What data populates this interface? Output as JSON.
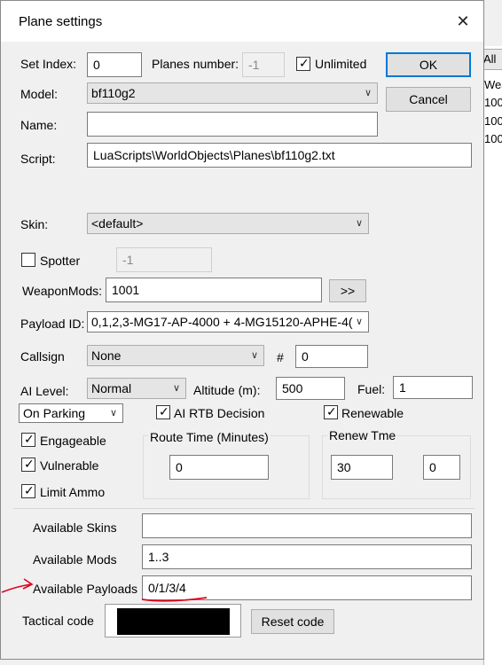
{
  "window": {
    "title": "Plane settings",
    "close_glyph": "✕"
  },
  "background_app": {
    "header_all": "All",
    "header_weapons": "Wea",
    "values": [
      "100",
      "100",
      "100"
    ]
  },
  "fields": {
    "set_index_label": "Set Index:",
    "set_index_value": "0",
    "planes_number_label": "Planes number:",
    "planes_number_value": "-1",
    "unlimited_label": "Unlimited",
    "model_label": "Model:",
    "model_value": "bf110g2",
    "name_label": "Name:",
    "name_value": "",
    "script_label": "Script:",
    "script_value": "LuaScripts\\WorldObjects\\Planes\\bf110g2.txt",
    "skin_label": "Skin:",
    "skin_value": "<default>",
    "spotter_label": "Spotter",
    "spotter_value": "-1",
    "weaponmods_label": "WeaponMods:",
    "weaponmods_value": "1001",
    "weaponmods_button": ">>",
    "payload_label": "Payload ID:",
    "payload_value": "0,1,2,3-MG17-AP-4000 + 4-MG15120-APHE-4(",
    "callsign_label": "Callsign",
    "callsign_value": "None",
    "hash_label": "#",
    "hash_value": "0",
    "ai_level_label": "AI Level:",
    "ai_level_value": "Normal",
    "altitude_label": "Altitude (m):",
    "altitude_value": "500",
    "fuel_label": "Fuel:",
    "fuel_value": "1",
    "start_value": "On Parking",
    "ai_rtb_label": "AI RTB Decision",
    "renewable_label": "Renewable",
    "engageable_label": "Engageable",
    "vulnerable_label": "Vulnerable",
    "limit_ammo_label": "Limit Ammo",
    "route_time_label": "Route Time (Minutes)",
    "route_time_value": "0",
    "renew_time_label": "Renew Tme",
    "renew_time_value_1": "30",
    "renew_time_value_2": "0",
    "available_skins_label": "Available Skins",
    "available_skins_value": "",
    "available_mods_label": "Available Mods",
    "available_mods_value": "1..3",
    "available_payloads_label": "Available Payloads",
    "available_payloads_value": "0/1/3/4",
    "tactical_code_label": "Tactical code",
    "reset_code_button": "Reset code"
  },
  "buttons": {
    "ok": "OK",
    "cancel": "Cancel"
  },
  "checkboxes": {
    "unlimited": true,
    "spotter": false,
    "ai_rtb": true,
    "renewable": true,
    "engageable": true,
    "vulnerable": true,
    "limit_ammo": true
  },
  "colors": {
    "annotation_red": "#e0001b",
    "tactical_code_swatch": "#000000",
    "ok_border": "#0078d7"
  },
  "icons": {
    "chevron": "chevron-down-icon",
    "check": "check-icon",
    "close": "close-icon"
  }
}
